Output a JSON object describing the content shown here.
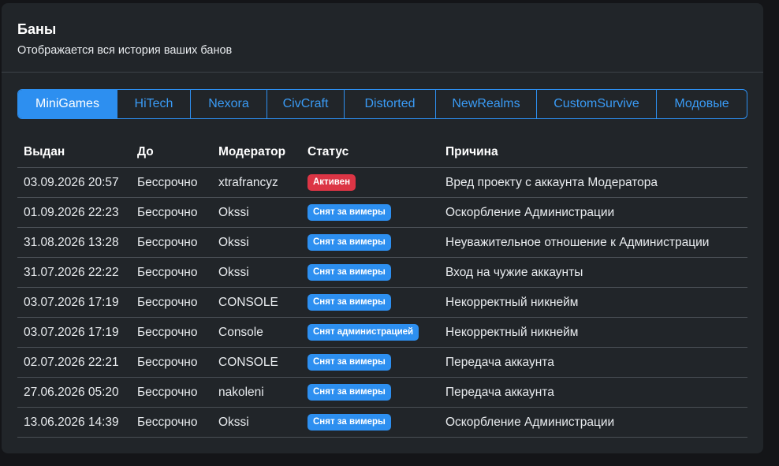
{
  "header": {
    "title": "Баны",
    "subtitle": "Отображается вся история ваших банов"
  },
  "tabs": [
    {
      "label": "MiniGames",
      "active": true
    },
    {
      "label": "HiTech",
      "active": false
    },
    {
      "label": "Nexora",
      "active": false
    },
    {
      "label": "CivCraft",
      "active": false
    },
    {
      "label": "Distorted",
      "active": false
    },
    {
      "label": "NewRealms",
      "active": false
    },
    {
      "label": "CustomSurvive",
      "active": false
    },
    {
      "label": "Модовые",
      "active": false
    }
  ],
  "table": {
    "columns": [
      "Выдан",
      "До",
      "Модератор",
      "Статус",
      "Причина"
    ],
    "rows": [
      {
        "issued": "03.09.2026 20:57",
        "until": "Бессрочно",
        "moderator": "xtrafrancyz",
        "status": "Активен",
        "status_color": "#dc3545",
        "reason": "Вред проекту с аккаунта Модератора"
      },
      {
        "issued": "01.09.2026 22:23",
        "until": "Бессрочно",
        "moderator": "Okssi",
        "status": "Снят за вимеры",
        "status_color": "#2d8ff0",
        "reason": "Оскорбление Администрации"
      },
      {
        "issued": "31.08.2026 13:28",
        "until": "Бессрочно",
        "moderator": "Okssi",
        "status": "Снят за вимеры",
        "status_color": "#2d8ff0",
        "reason": "Неуважительное отношение к Администрации"
      },
      {
        "issued": "31.07.2026 22:22",
        "until": "Бессрочно",
        "moderator": "Okssi",
        "status": "Снят за вимеры",
        "status_color": "#2d8ff0",
        "reason": "Вход на чужие аккаунты"
      },
      {
        "issued": "03.07.2026 17:19",
        "until": "Бессрочно",
        "moderator": "CONSOLE",
        "status": "Снят за вимеры",
        "status_color": "#2d8ff0",
        "reason": "Некорректный никнейм"
      },
      {
        "issued": "03.07.2026 17:19",
        "until": "Бессрочно",
        "moderator": "Console",
        "status": "Снят администрацией",
        "status_color": "#2d8ff0",
        "reason": "Некорректный никнейм"
      },
      {
        "issued": "02.07.2026 22:21",
        "until": "Бессрочно",
        "moderator": "CONSOLE",
        "status": "Снят за вимеры",
        "status_color": "#2d8ff0",
        "reason": "Передача аккаунта"
      },
      {
        "issued": "27.06.2026 05:20",
        "until": "Бессрочно",
        "moderator": "nakoleni",
        "status": "Снят за вимеры",
        "status_color": "#2d8ff0",
        "reason": "Передача аккаунта"
      },
      {
        "issued": "13.06.2026 14:39",
        "until": "Бессрочно",
        "moderator": "Okssi",
        "status": "Снят за вимеры",
        "status_color": "#2d8ff0",
        "reason": "Оскорбление Администрации"
      }
    ]
  }
}
